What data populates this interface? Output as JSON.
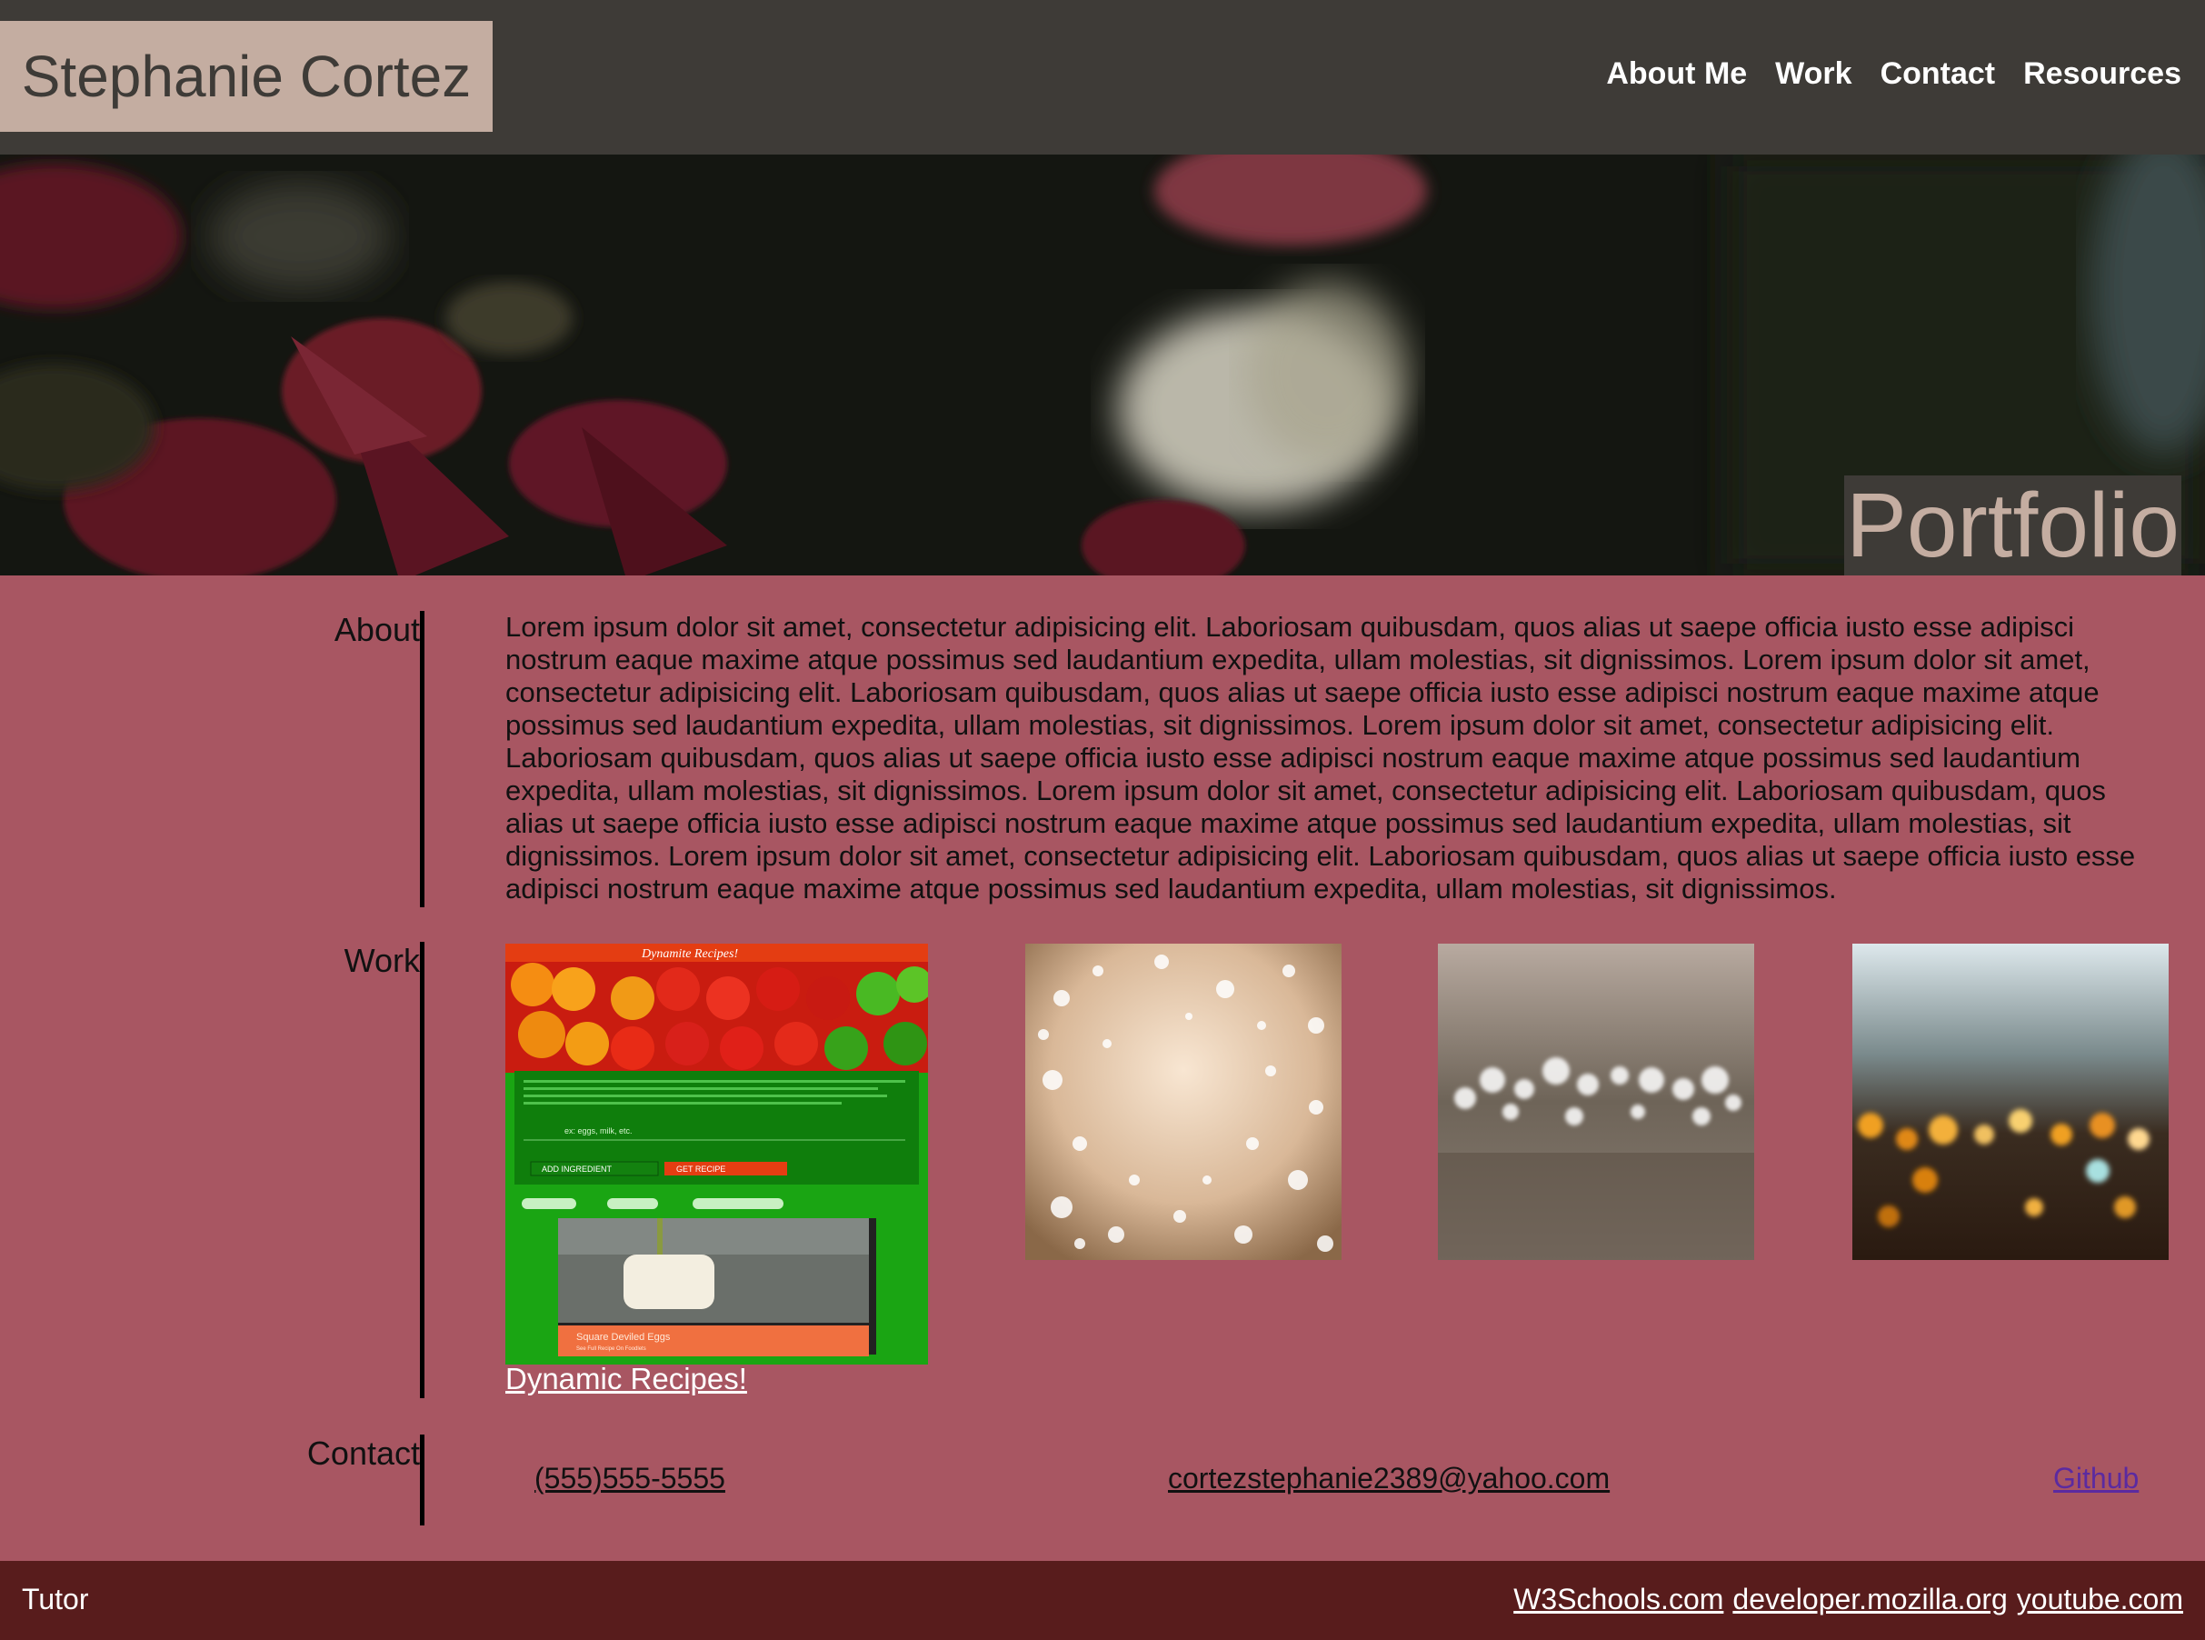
{
  "header": {
    "brand": "Stephanie Cortez",
    "nav": [
      {
        "label": "About Me"
      },
      {
        "label": "Work"
      },
      {
        "label": "Contact"
      },
      {
        "label": "Resources"
      }
    ]
  },
  "hero": {
    "title": "Portfolio"
  },
  "about": {
    "label": "About",
    "text": "Lorem ipsum dolor sit amet, consectetur adipisicing elit. Laboriosam quibusdam, quos alias ut saepe officia iusto esse adipisci nostrum eaque maxime atque possimus sed laudantium expedita, ullam molestias, sit dignissimos. Lorem ipsum dolor sit amet, consectetur adipisicing elit. Laboriosam quibusdam, quos alias ut saepe officia iusto esse adipisci nostrum eaque maxime atque possimus sed laudantium expedita, ullam molestias, sit dignissimos. Lorem ipsum dolor sit amet, consectetur adipisicing elit. Laboriosam quibusdam, quos alias ut saepe officia iusto esse adipisci nostrum eaque maxime atque possimus sed laudantium expedita, ullam molestias, sit dignissimos. Lorem ipsum dolor sit amet, consectetur adipisicing elit. Laboriosam quibusdam, quos alias ut saepe officia iusto esse adipisci nostrum eaque maxime atque possimus sed laudantium expedita, ullam molestias, sit dignissimos. Lorem ipsum dolor sit amet, consectetur adipisicing elit. Laboriosam quibusdam, quos alias ut saepe officia iusto esse adipisci nostrum eaque maxime atque possimus sed laudantium expedita, ullam molestias, sit dignissimos."
  },
  "work": {
    "label": "Work",
    "project_link": "Dynamic Recipes!",
    "app_preview": {
      "title": "Dynamite Recipes!",
      "input_hint": "ex: eggs, milk, etc.",
      "add_button": "ADD INGREDIENT",
      "get_button": "GET RECIPE",
      "recipe_title": "Square Deviled Eggs",
      "recipe_sub": "See Full Recipe On Foodlets"
    }
  },
  "contact": {
    "label": "Contact",
    "phone": "(555)555-5555",
    "email": "cortezstephanie2389@yahoo.com",
    "github": "Github"
  },
  "footer": {
    "left": "Tutor",
    "links": [
      {
        "label": "W3Schools.com"
      },
      {
        "label": "developer.mozilla.org"
      },
      {
        "label": "youtube.com"
      }
    ]
  },
  "colors": {
    "header_bg": "#3e3b37",
    "brand_bg": "#c4ada1",
    "page_bg": "#a85662",
    "footer_bg": "#581c1c"
  }
}
